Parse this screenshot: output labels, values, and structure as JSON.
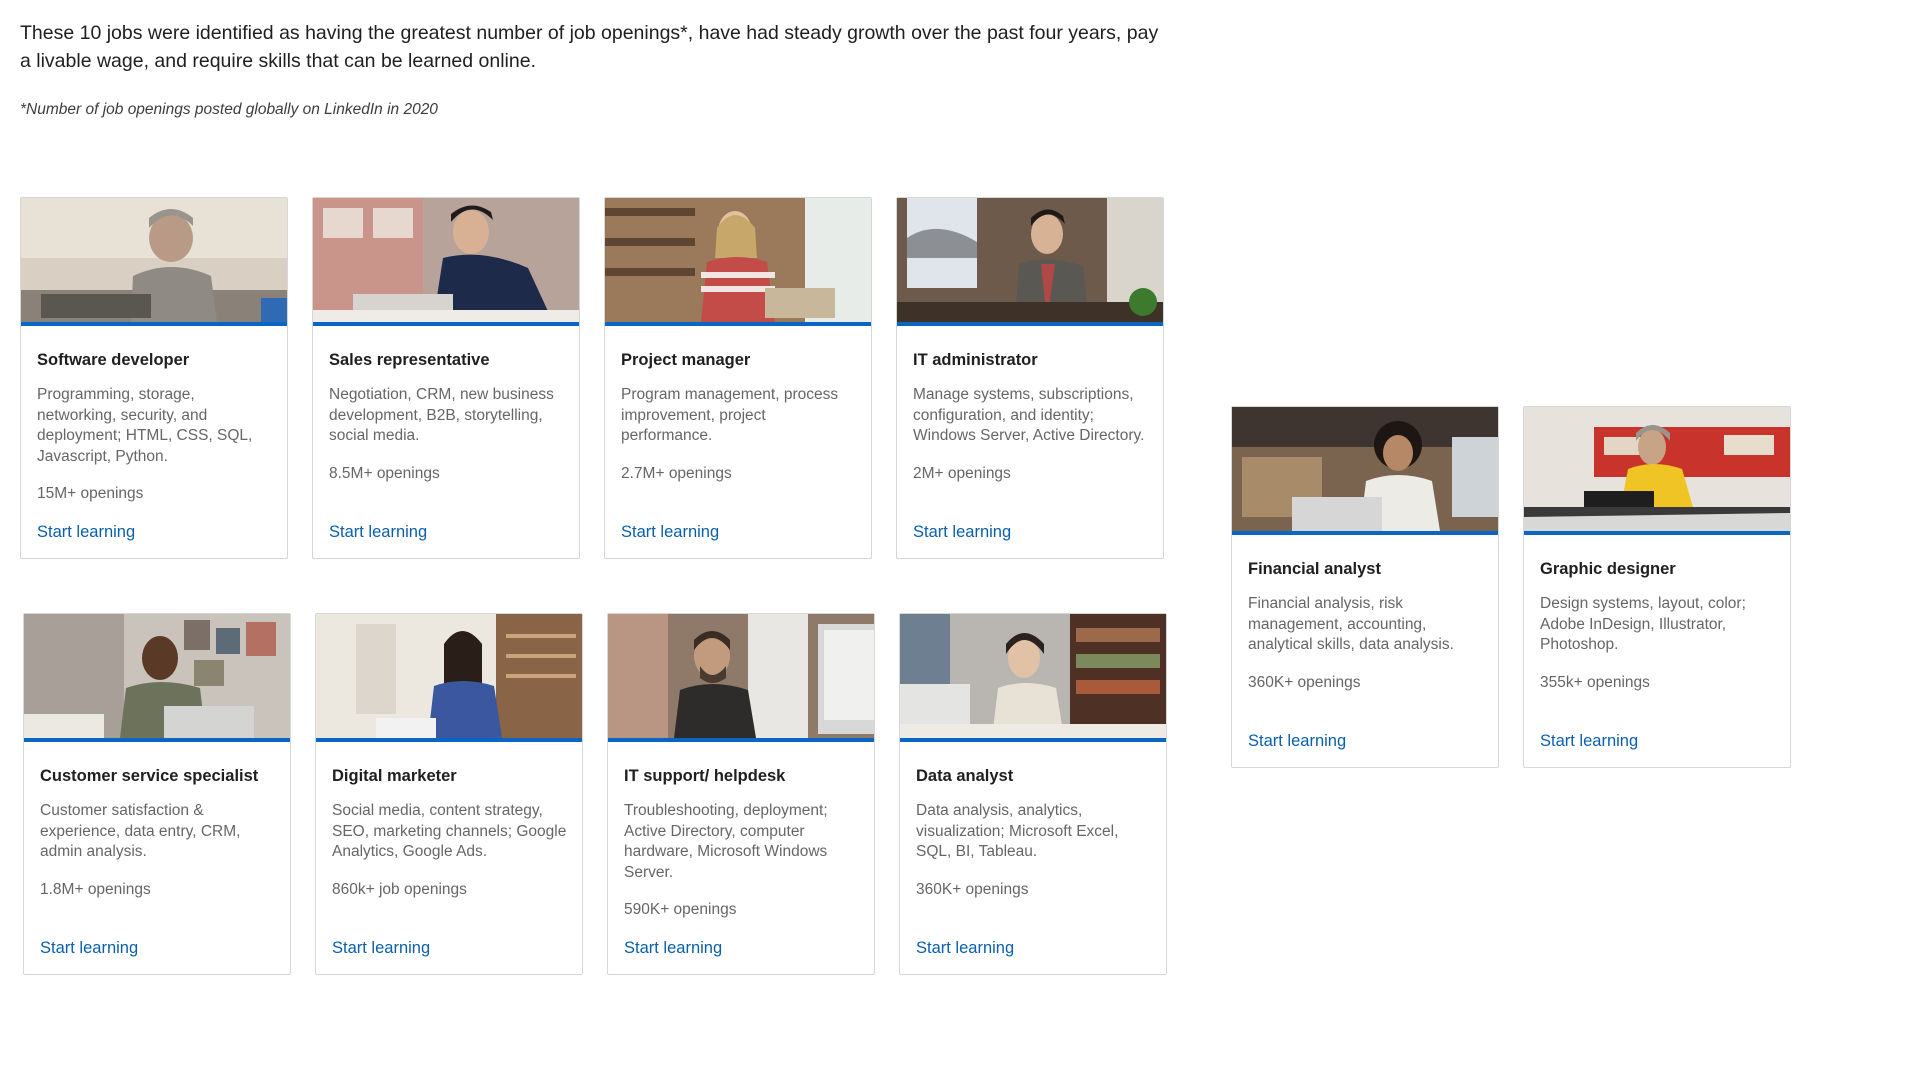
{
  "intro": {
    "text": "These 10 jobs were identified as having the greatest number of job openings*, have had steady growth over the past four years, pay a livable wage, and require skills that can be learned online.",
    "footnote": "*Number of job openings posted globally on LinkedIn in 2020"
  },
  "cards": [
    {
      "title": "Software developer",
      "skills": "Programming, storage, networking, security, and deployment; HTML, CSS, SQL, Javascript, Python.",
      "openings": "15M+ openings",
      "cta": "Start learning",
      "photo_icon": "person-at-laptop-photo"
    },
    {
      "title": "Sales representative",
      "skills": "Negotiation, CRM, new business development, B2B, storytelling, social media.",
      "openings": "8.5M+ openings",
      "cta": "Start learning",
      "photo_icon": "person-on-phone-photo"
    },
    {
      "title": "Project manager",
      "skills": "Program management, process improvement, project performance.",
      "openings": "2.7M+ openings",
      "cta": "Start learning",
      "photo_icon": "person-in-shop-photo"
    },
    {
      "title": "IT administrator",
      "skills": "Manage systems, subscriptions, configuration, and identity; Windows Server, Active Directory.",
      "openings": "2M+ openings",
      "cta": "Start learning",
      "photo_icon": "person-at-window-photo"
    },
    {
      "title": "Customer service specialist",
      "skills": "Customer satisfaction & experience, data entry, CRM, admin analysis.",
      "openings": "1.8M+ openings",
      "cta": "Start learning",
      "photo_icon": "person-smiling-photo"
    },
    {
      "title": "Digital marketer",
      "skills": "Social media, content strategy, SEO, marketing channels; Google Analytics, Google Ads.",
      "openings": "860k+ job openings",
      "cta": "Start learning",
      "photo_icon": "person-blue-shirt-photo"
    },
    {
      "title": "IT support/ helpdesk",
      "skills": "Troubleshooting, deployment; Active Directory, computer hardware, Microsoft Windows Server.",
      "openings": "590K+ openings",
      "cta": "Start learning",
      "photo_icon": "person-at-monitor-photo"
    },
    {
      "title": "Data analyst",
      "skills": "Data analysis, analytics, visualization; Microsoft Excel, SQL, BI, Tableau.",
      "openings": "360K+ openings",
      "cta": "Start learning",
      "photo_icon": "person-with-headphones-photo"
    },
    {
      "title": "Financial analyst",
      "skills": "Financial analysis, risk management, accounting, analytical skills, data analysis.",
      "openings": "360K+ openings",
      "cta": "Start learning",
      "photo_icon": "person-in-office-photo"
    },
    {
      "title": "Graphic designer",
      "skills": "Design systems, layout, color; Adobe InDesign, Illustrator, Photoshop.",
      "openings": "355k+ openings",
      "cta": "Start learning",
      "photo_icon": "person-on-floor-photo"
    }
  ],
  "colors": {
    "accent_bar": "#0a66c2",
    "link": "#0a5fad",
    "muted_text": "#666666",
    "card_border": "#d6d6d6"
  }
}
